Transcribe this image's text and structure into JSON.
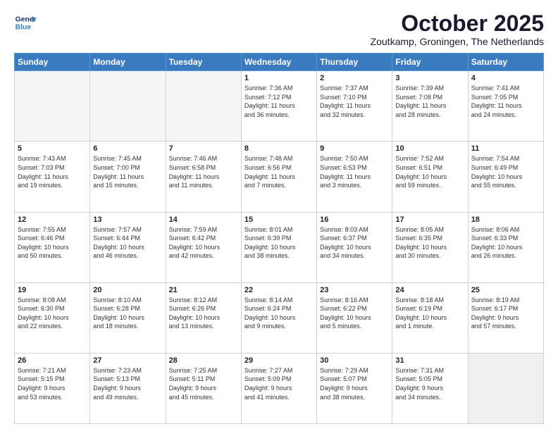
{
  "logo": {
    "line1": "General",
    "line2": "Blue"
  },
  "title": "October 2025",
  "location": "Zoutkamp, Groningen, The Netherlands",
  "weekdays": [
    "Sunday",
    "Monday",
    "Tuesday",
    "Wednesday",
    "Thursday",
    "Friday",
    "Saturday"
  ],
  "weeks": [
    [
      {
        "day": "",
        "info": ""
      },
      {
        "day": "",
        "info": ""
      },
      {
        "day": "",
        "info": ""
      },
      {
        "day": "1",
        "info": "Sunrise: 7:36 AM\nSunset: 7:12 PM\nDaylight: 11 hours\nand 36 minutes."
      },
      {
        "day": "2",
        "info": "Sunrise: 7:37 AM\nSunset: 7:10 PM\nDaylight: 11 hours\nand 32 minutes."
      },
      {
        "day": "3",
        "info": "Sunrise: 7:39 AM\nSunset: 7:08 PM\nDaylight: 11 hours\nand 28 minutes."
      },
      {
        "day": "4",
        "info": "Sunrise: 7:41 AM\nSunset: 7:05 PM\nDaylight: 11 hours\nand 24 minutes."
      }
    ],
    [
      {
        "day": "5",
        "info": "Sunrise: 7:43 AM\nSunset: 7:03 PM\nDaylight: 11 hours\nand 19 minutes."
      },
      {
        "day": "6",
        "info": "Sunrise: 7:45 AM\nSunset: 7:00 PM\nDaylight: 11 hours\nand 15 minutes."
      },
      {
        "day": "7",
        "info": "Sunrise: 7:46 AM\nSunset: 6:58 PM\nDaylight: 11 hours\nand 11 minutes."
      },
      {
        "day": "8",
        "info": "Sunrise: 7:48 AM\nSunset: 6:56 PM\nDaylight: 11 hours\nand 7 minutes."
      },
      {
        "day": "9",
        "info": "Sunrise: 7:50 AM\nSunset: 6:53 PM\nDaylight: 11 hours\nand 3 minutes."
      },
      {
        "day": "10",
        "info": "Sunrise: 7:52 AM\nSunset: 6:51 PM\nDaylight: 10 hours\nand 59 minutes."
      },
      {
        "day": "11",
        "info": "Sunrise: 7:54 AM\nSunset: 6:49 PM\nDaylight: 10 hours\nand 55 minutes."
      }
    ],
    [
      {
        "day": "12",
        "info": "Sunrise: 7:55 AM\nSunset: 6:46 PM\nDaylight: 10 hours\nand 50 minutes."
      },
      {
        "day": "13",
        "info": "Sunrise: 7:57 AM\nSunset: 6:44 PM\nDaylight: 10 hours\nand 46 minutes."
      },
      {
        "day": "14",
        "info": "Sunrise: 7:59 AM\nSunset: 6:42 PM\nDaylight: 10 hours\nand 42 minutes."
      },
      {
        "day": "15",
        "info": "Sunrise: 8:01 AM\nSunset: 6:39 PM\nDaylight: 10 hours\nand 38 minutes."
      },
      {
        "day": "16",
        "info": "Sunrise: 8:03 AM\nSunset: 6:37 PM\nDaylight: 10 hours\nand 34 minutes."
      },
      {
        "day": "17",
        "info": "Sunrise: 8:05 AM\nSunset: 6:35 PM\nDaylight: 10 hours\nand 30 minutes."
      },
      {
        "day": "18",
        "info": "Sunrise: 8:06 AM\nSunset: 6:33 PM\nDaylight: 10 hours\nand 26 minutes."
      }
    ],
    [
      {
        "day": "19",
        "info": "Sunrise: 8:08 AM\nSunset: 6:30 PM\nDaylight: 10 hours\nand 22 minutes."
      },
      {
        "day": "20",
        "info": "Sunrise: 8:10 AM\nSunset: 6:28 PM\nDaylight: 10 hours\nand 18 minutes."
      },
      {
        "day": "21",
        "info": "Sunrise: 8:12 AM\nSunset: 6:26 PM\nDaylight: 10 hours\nand 13 minutes."
      },
      {
        "day": "22",
        "info": "Sunrise: 8:14 AM\nSunset: 6:24 PM\nDaylight: 10 hours\nand 9 minutes."
      },
      {
        "day": "23",
        "info": "Sunrise: 8:16 AM\nSunset: 6:22 PM\nDaylight: 10 hours\nand 5 minutes."
      },
      {
        "day": "24",
        "info": "Sunrise: 8:18 AM\nSunset: 6:19 PM\nDaylight: 10 hours\nand 1 minute."
      },
      {
        "day": "25",
        "info": "Sunrise: 8:19 AM\nSunset: 6:17 PM\nDaylight: 9 hours\nand 57 minutes."
      }
    ],
    [
      {
        "day": "26",
        "info": "Sunrise: 7:21 AM\nSunset: 5:15 PM\nDaylight: 9 hours\nand 53 minutes."
      },
      {
        "day": "27",
        "info": "Sunrise: 7:23 AM\nSunset: 5:13 PM\nDaylight: 9 hours\nand 49 minutes."
      },
      {
        "day": "28",
        "info": "Sunrise: 7:25 AM\nSunset: 5:11 PM\nDaylight: 9 hours\nand 45 minutes."
      },
      {
        "day": "29",
        "info": "Sunrise: 7:27 AM\nSunset: 5:09 PM\nDaylight: 9 hours\nand 41 minutes."
      },
      {
        "day": "30",
        "info": "Sunrise: 7:29 AM\nSunset: 5:07 PM\nDaylight: 9 hours\nand 38 minutes."
      },
      {
        "day": "31",
        "info": "Sunrise: 7:31 AM\nSunset: 5:05 PM\nDaylight: 9 hours\nand 34 minutes."
      },
      {
        "day": "",
        "info": ""
      }
    ]
  ]
}
